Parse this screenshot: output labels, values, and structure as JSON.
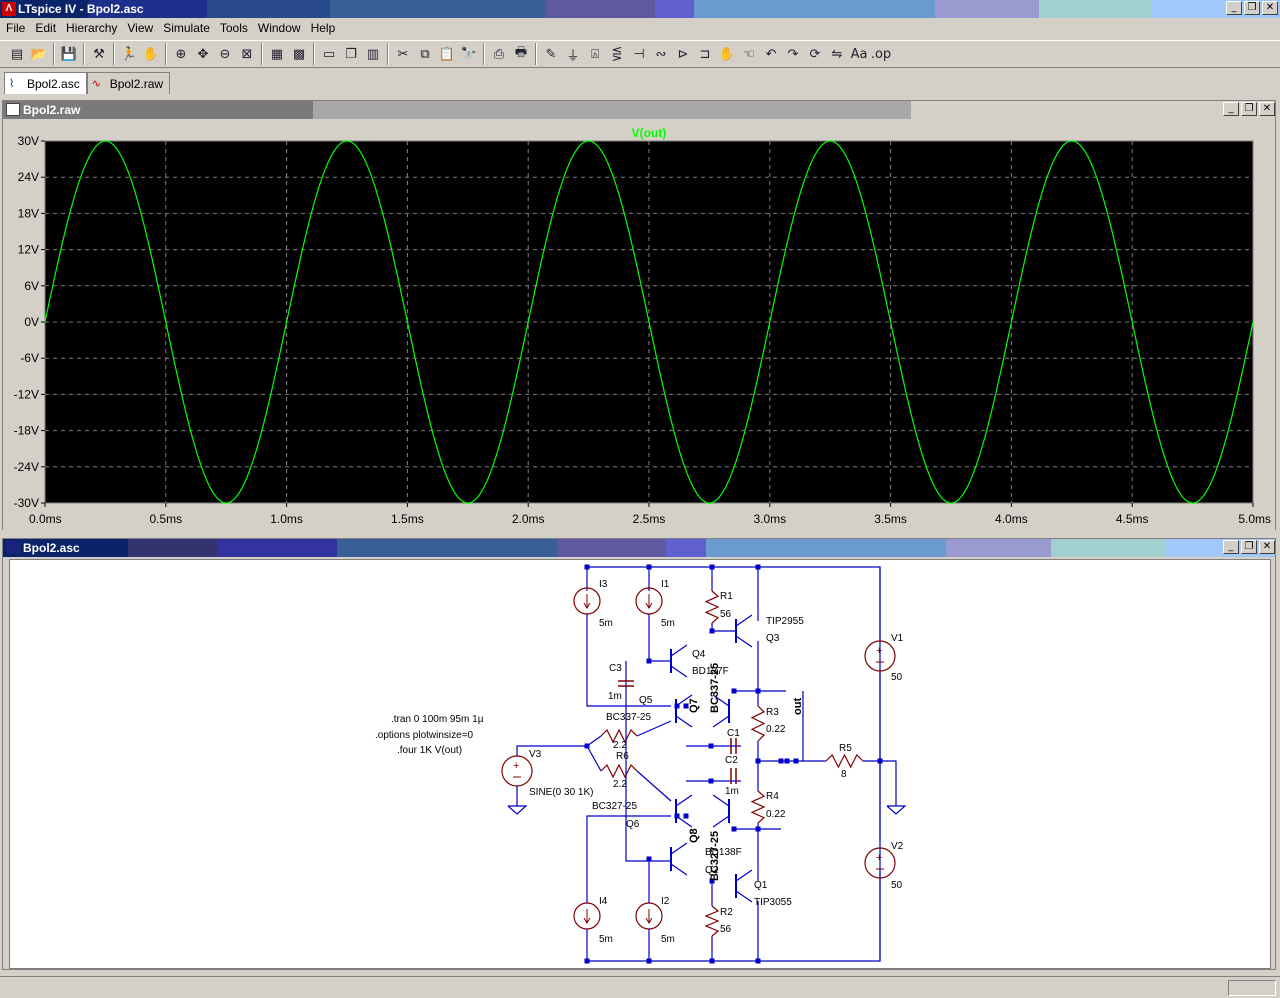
{
  "app": {
    "title": "LTspice IV - Bpol2.asc",
    "titlebar_colors": [
      "#1a237e",
      "#283593",
      "#3949ab",
      "#3f51b5",
      "#5c6bc0",
      "#3949ab",
      "#5e6bb0",
      "#6a7dc8",
      "#7b8bd4",
      "#5c7fc8",
      "#6fa0d0",
      "#8ebee0",
      "#9ad0e0",
      "#a0c8f0"
    ]
  },
  "window_buttons": {
    "minimize": "_",
    "restore": "❐",
    "close": "✕"
  },
  "menu": [
    {
      "label": "File"
    },
    {
      "label": "Edit"
    },
    {
      "label": "Hierarchy"
    },
    {
      "label": "View"
    },
    {
      "label": "Simulate"
    },
    {
      "label": "Tools"
    },
    {
      "label": "Window"
    },
    {
      "label": "Help"
    }
  ],
  "toolbar": [
    {
      "icon": "new-schematic-icon",
      "glyph": "▤"
    },
    {
      "icon": "open-folder-icon",
      "glyph": "📂"
    },
    {
      "sep": true
    },
    {
      "icon": "save-icon",
      "glyph": "💾"
    },
    {
      "sep": true
    },
    {
      "icon": "control-panel-icon",
      "glyph": "⚒"
    },
    {
      "sep": true
    },
    {
      "icon": "run-icon",
      "glyph": "🏃"
    },
    {
      "icon": "halt-icon",
      "glyph": "✋"
    },
    {
      "sep": true
    },
    {
      "icon": "zoom-in-icon",
      "glyph": "⊕"
    },
    {
      "icon": "pan-icon",
      "glyph": "✥"
    },
    {
      "icon": "zoom-out-icon",
      "glyph": "⊖"
    },
    {
      "icon": "zoom-fit-icon",
      "glyph": "⊠"
    },
    {
      "sep": true
    },
    {
      "icon": "autorange-icon",
      "glyph": "▦"
    },
    {
      "icon": "grid-icon",
      "glyph": "▩"
    },
    {
      "sep": true
    },
    {
      "icon": "tile-horizontal-icon",
      "glyph": "▭"
    },
    {
      "icon": "cascade-icon",
      "glyph": "❐"
    },
    {
      "icon": "tile-vertical-icon",
      "glyph": "▥"
    },
    {
      "sep": true
    },
    {
      "icon": "cut-icon",
      "glyph": "✂"
    },
    {
      "icon": "copy-icon",
      "glyph": "⧉"
    },
    {
      "icon": "paste-icon",
      "glyph": "📋"
    },
    {
      "icon": "find-icon",
      "glyph": "🔭"
    },
    {
      "sep": true
    },
    {
      "icon": "print-setup-icon",
      "glyph": "⎙"
    },
    {
      "icon": "print-icon",
      "glyph": "🖶"
    },
    {
      "sep": true
    },
    {
      "icon": "wire-icon",
      "glyph": "✎"
    },
    {
      "icon": "ground-icon",
      "glyph": "⏚"
    },
    {
      "icon": "label-net-icon",
      "glyph": "⍓"
    },
    {
      "icon": "resistor-icon",
      "glyph": "⋚"
    },
    {
      "icon": "capacitor-icon",
      "glyph": "⊣"
    },
    {
      "icon": "inductor-icon",
      "glyph": "∾"
    },
    {
      "icon": "diode-icon",
      "glyph": "⊳"
    },
    {
      "icon": "component-icon",
      "glyph": "⊐"
    },
    {
      "icon": "move-icon",
      "glyph": "✋"
    },
    {
      "icon": "drag-icon",
      "glyph": "☜"
    },
    {
      "icon": "undo-icon",
      "glyph": "↶"
    },
    {
      "icon": "redo-icon",
      "glyph": "↷"
    },
    {
      "icon": "rotate-icon",
      "glyph": "⟳"
    },
    {
      "icon": "mirror-icon",
      "glyph": "⇋"
    },
    {
      "icon": "text-icon",
      "glyph": "Aa"
    },
    {
      "icon": "spice-directive-icon",
      "glyph": ".op"
    }
  ],
  "tabs": [
    {
      "label": "Bpol2.asc",
      "icon": "schematic-icon",
      "active": true
    },
    {
      "label": "Bpol2.raw",
      "icon": "waveform-icon",
      "active": false
    }
  ],
  "plot_window": {
    "title": "Bpol2.raw"
  },
  "schematic_window": {
    "title": "Bpol2.asc"
  },
  "chart_data": {
    "type": "line",
    "title": "V(out)",
    "background": "#000000",
    "trace_color": "#00ff00",
    "grid": true,
    "xlim": [
      0,
      5
    ],
    "ylim": [
      -30,
      30
    ],
    "x_ticks": [
      "0.0ms",
      "0.5ms",
      "1.0ms",
      "1.5ms",
      "2.0ms",
      "2.5ms",
      "3.0ms",
      "3.5ms",
      "4.0ms",
      "4.5ms",
      "5.0ms"
    ],
    "y_ticks": [
      "30V",
      "24V",
      "18V",
      "12V",
      "6V",
      "0V",
      "-6V",
      "-12V",
      "-18V",
      "-24V",
      "-30V"
    ],
    "series": [
      {
        "name": "V(out)",
        "amplitude": 30,
        "frequency_khz": 1,
        "offset": 0
      }
    ]
  },
  "schematic": {
    "directives": [
      ".tran 0 100m 95m 1µ",
      ".options plotwinsize=0",
      ".four 1K V(out)"
    ],
    "labels": [
      {
        "text": "I3"
      },
      {
        "text": "5m"
      },
      {
        "text": "I1"
      },
      {
        "text": "5m"
      },
      {
        "text": "R1"
      },
      {
        "text": "56"
      },
      {
        "text": "TIP2955"
      },
      {
        "text": "Q3"
      },
      {
        "text": "Q4"
      },
      {
        "text": "BD137F"
      },
      {
        "text": "C3"
      },
      {
        "text": "1m"
      },
      {
        "text": "Q5"
      },
      {
        "text": "BC337-25"
      },
      {
        "text": "Q7"
      },
      {
        "text": "BC337-25"
      },
      {
        "text": "out"
      },
      {
        "text": "R3"
      },
      {
        "text": "0.22"
      },
      {
        "text": "C1"
      },
      {
        "text": "R6"
      },
      {
        "text": "2.2"
      },
      {
        "text": "V3"
      },
      {
        "text": "2.2"
      },
      {
        "text": "C2"
      },
      {
        "text": "1m"
      },
      {
        "text": "SINE(0 30 1K)"
      },
      {
        "text": "BC327-25"
      },
      {
        "text": "R5"
      },
      {
        "text": "8"
      },
      {
        "text": "R4"
      },
      {
        "text": "0.22"
      },
      {
        "text": "Q6"
      },
      {
        "text": "Q8"
      },
      {
        "text": "BC327-25"
      },
      {
        "text": "BD138F"
      },
      {
        "text": "Q2"
      },
      {
        "text": "Q1"
      },
      {
        "text": "TIP3055"
      },
      {
        "text": "I4"
      },
      {
        "text": "5m"
      },
      {
        "text": "I2"
      },
      {
        "text": "5m"
      },
      {
        "text": "R2"
      },
      {
        "text": "56"
      },
      {
        "text": "V1"
      },
      {
        "text": "50"
      },
      {
        "text": "V2"
      },
      {
        "text": "50"
      }
    ]
  }
}
